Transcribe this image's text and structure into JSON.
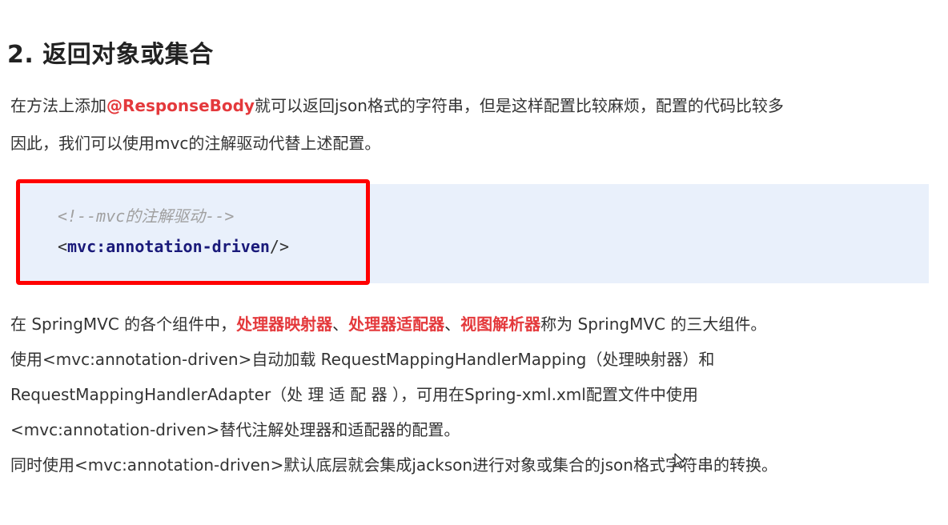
{
  "heading": "2. 返回对象或集合",
  "intro": {
    "line1_before": "在方法上添加",
    "line1_highlight": "@ResponseBody",
    "line1_after": "就可以返回json格式的字符串，但是这样配置比较麻烦，配置的代码比较多",
    "line2": "因此，我们可以使用mvc的注解驱动代替上述配置。"
  },
  "code": {
    "comment": "<!--mvc的注解驱动-->",
    "tag_open": "<",
    "tag_name": "mvc:annotation-driven",
    "tag_close": "/>"
  },
  "body": {
    "line1_before": "在 SpringMVC 的各个组件中，",
    "line1_hl1": "处理器映射器",
    "line1_sep1": "、",
    "line1_hl2": "处理器适配器",
    "line1_sep2": "、",
    "line1_hl3": "视图解析器",
    "line1_after": "称为 SpringMVC 的三大组件。",
    "line2": "使用<mvc:annotation-driven>自动加载 RequestMappingHandlerMapping（处理映射器）和",
    "line3": "RequestMappingHandlerAdapter（处 理 适 配 器 ），可用在Spring-xml.xml配置文件中使用",
    "line4": "<mvc:annotation-driven>替代注解处理器和适配器的配置。",
    "line5": "同时使用<mvc:annotation-driven>默认底层就会集成jackson进行对象或集合的json格式字符串的转换。"
  },
  "colors": {
    "highlight_red": "#e4393c",
    "frame_red": "#ff0000",
    "code_bg": "#e9f0fb"
  },
  "icons": {
    "cursor": "mouse-pointer-icon"
  }
}
